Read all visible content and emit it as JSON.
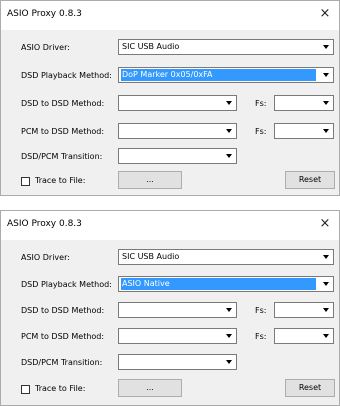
{
  "windows": [
    {
      "title": "ASIO Proxy 0.8.3",
      "close_glyph": "×",
      "asio_driver": {
        "label": "ASIO Driver:",
        "value": "SIC USB Audio"
      },
      "dsd_playback_method": {
        "label": "DSD Playback Method:",
        "value": "DoP Marker 0x05/0xFA"
      },
      "dsd_to_dsd_method": {
        "label": "DSD to DSD Method:",
        "value": ""
      },
      "dsd_to_dsd_fs": {
        "label": "Fs:",
        "value": ""
      },
      "pcm_to_dsd_method": {
        "label": "PCM to DSD Method:",
        "value": ""
      },
      "pcm_to_dsd_fs": {
        "label": "Fs:",
        "value": ""
      },
      "dsd_pcm_transition": {
        "label": "DSD/PCM Transition:",
        "value": ""
      },
      "trace_to_file": {
        "label": "Trace to File:",
        "checked": false
      },
      "browse_label": "...",
      "reset_label": "Reset"
    },
    {
      "title": "ASIO Proxy 0.8.3",
      "close_glyph": "×",
      "asio_driver": {
        "label": "ASIO Driver:",
        "value": "SIC USB Audio"
      },
      "dsd_playback_method": {
        "label": "DSD Playback Method:",
        "value": "ASIO Native"
      },
      "dsd_to_dsd_method": {
        "label": "DSD to DSD Method:",
        "value": ""
      },
      "dsd_to_dsd_fs": {
        "label": "Fs:",
        "value": ""
      },
      "pcm_to_dsd_method": {
        "label": "PCM to DSD Method:",
        "value": ""
      },
      "pcm_to_dsd_fs": {
        "label": "Fs:",
        "value": ""
      },
      "dsd_pcm_transition": {
        "label": "DSD/PCM Transition:",
        "value": ""
      },
      "trace_to_file": {
        "label": "Trace to File:",
        "checked": false
      },
      "browse_label": "...",
      "reset_label": "Reset"
    }
  ],
  "colors": {
    "window_bg": "#f0f0f0",
    "titlebar_bg": "#ffffff",
    "selection_bg": "#3399ff",
    "selection_text": "#ffffff",
    "border": "#7a7a7a"
  }
}
